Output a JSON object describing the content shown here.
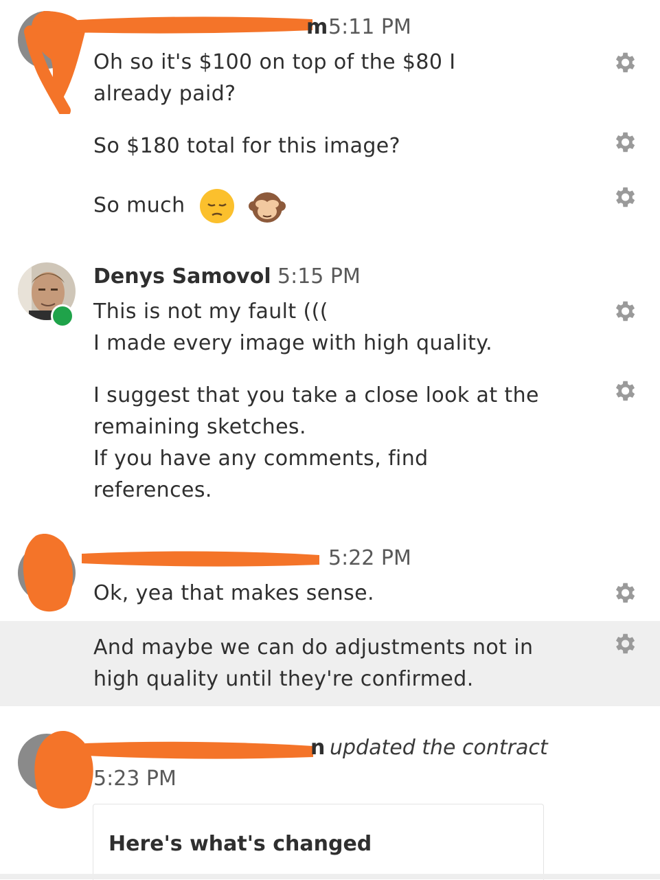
{
  "colors": {
    "redaction": "#f47429",
    "online": "#1fa34a",
    "highlight": "#efefef",
    "gear": "#9a9a9a"
  },
  "messages": {
    "g1": {
      "name_visible": "m",
      "time": "5:11 PM",
      "m1": "Oh so it's $100 on top of the $80 I already paid?",
      "m2": "So $180 total for this image?",
      "m3": "So much"
    },
    "g2": {
      "name": "Denys Samovol",
      "time": "5:15 PM",
      "m1_line1": "This is not my fault (((",
      "m1_line2": "I made every image with high quality.",
      "m2_line1": "I suggest that you take a close look at the",
      "m2_line2": "remaining sketches.",
      "m2_line3": "If you have any comments, find",
      "m2_line4": "references."
    },
    "g3": {
      "time": "5:22 PM",
      "m1": "Ok, yea that makes sense.",
      "m2_line1": "And maybe we can do adjustments not in",
      "m2_line2": "high quality until they're confirmed."
    },
    "g4": {
      "name_visible": "n",
      "action": "updated the contract",
      "time": "5:23 PM",
      "card_title": "Here's what's changed"
    }
  },
  "icons": {
    "gear": "gear-icon",
    "emoji1": "pensive-face-emoji",
    "emoji2": "see-no-evil-monkey-emoji"
  }
}
